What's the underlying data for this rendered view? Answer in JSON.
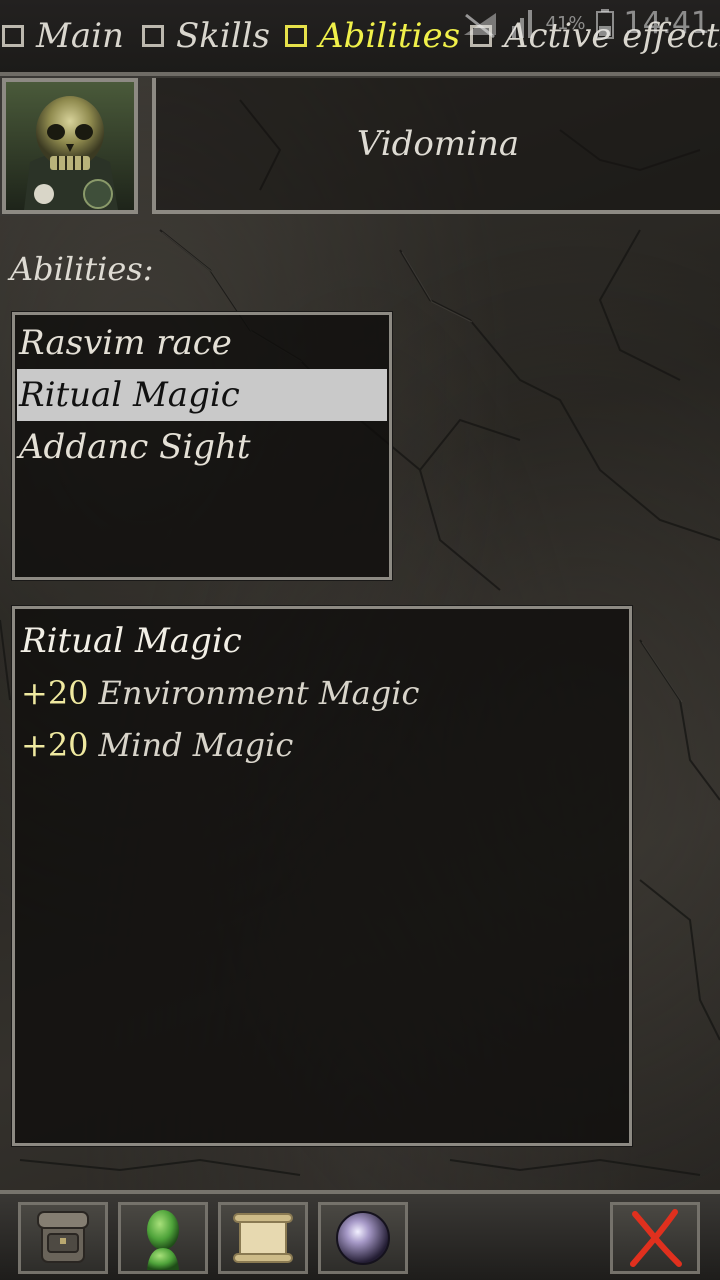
{
  "tabs": [
    {
      "label": "Main",
      "active": false
    },
    {
      "label": "Skills",
      "active": false
    },
    {
      "label": "Abilities",
      "active": true
    },
    {
      "label": "Active effects",
      "active": false
    }
  ],
  "status_bar": {
    "battery": "41%",
    "time": "14:41"
  },
  "character": {
    "name": "Vidomina",
    "portrait": "skull-helmet-portrait"
  },
  "abilities_label": "Abilities:",
  "abilities": [
    {
      "label": "Rasvim race",
      "selected": false
    },
    {
      "label": "Ritual Magic",
      "selected": true
    },
    {
      "label": "Addanc Sight",
      "selected": false
    }
  ],
  "detail": {
    "title": "Ritual Magic",
    "effects": [
      {
        "bonus": "+20",
        "skill": "Environment Magic"
      },
      {
        "bonus": "+20",
        "skill": "Mind Magic"
      }
    ]
  },
  "toolbar": {
    "inventory_icon": "backpack-icon",
    "character_icon": "head-icon",
    "journal_icon": "scroll-icon",
    "magic_icon": "orb-icon",
    "close_label": "X"
  },
  "colors": {
    "active_tab": "#f0f04a",
    "selection": "#c9c9c9",
    "close_red": "#e0301e"
  }
}
